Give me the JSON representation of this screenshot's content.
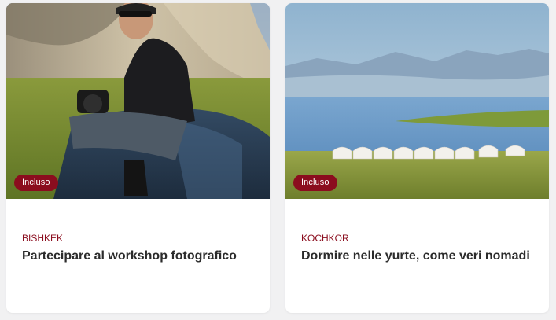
{
  "cards": [
    {
      "badge": "Incluso",
      "location": "BISHKEK",
      "title": "Partecipare al workshop fotografico"
    },
    {
      "badge": "Incluso",
      "location": "KOCHKOR",
      "title": "Dormire nelle yurte, come veri nomadi"
    }
  ],
  "colors": {
    "accent": "#8b0d1e",
    "title": "#2b2b2b",
    "background": "#f1f1f2"
  }
}
